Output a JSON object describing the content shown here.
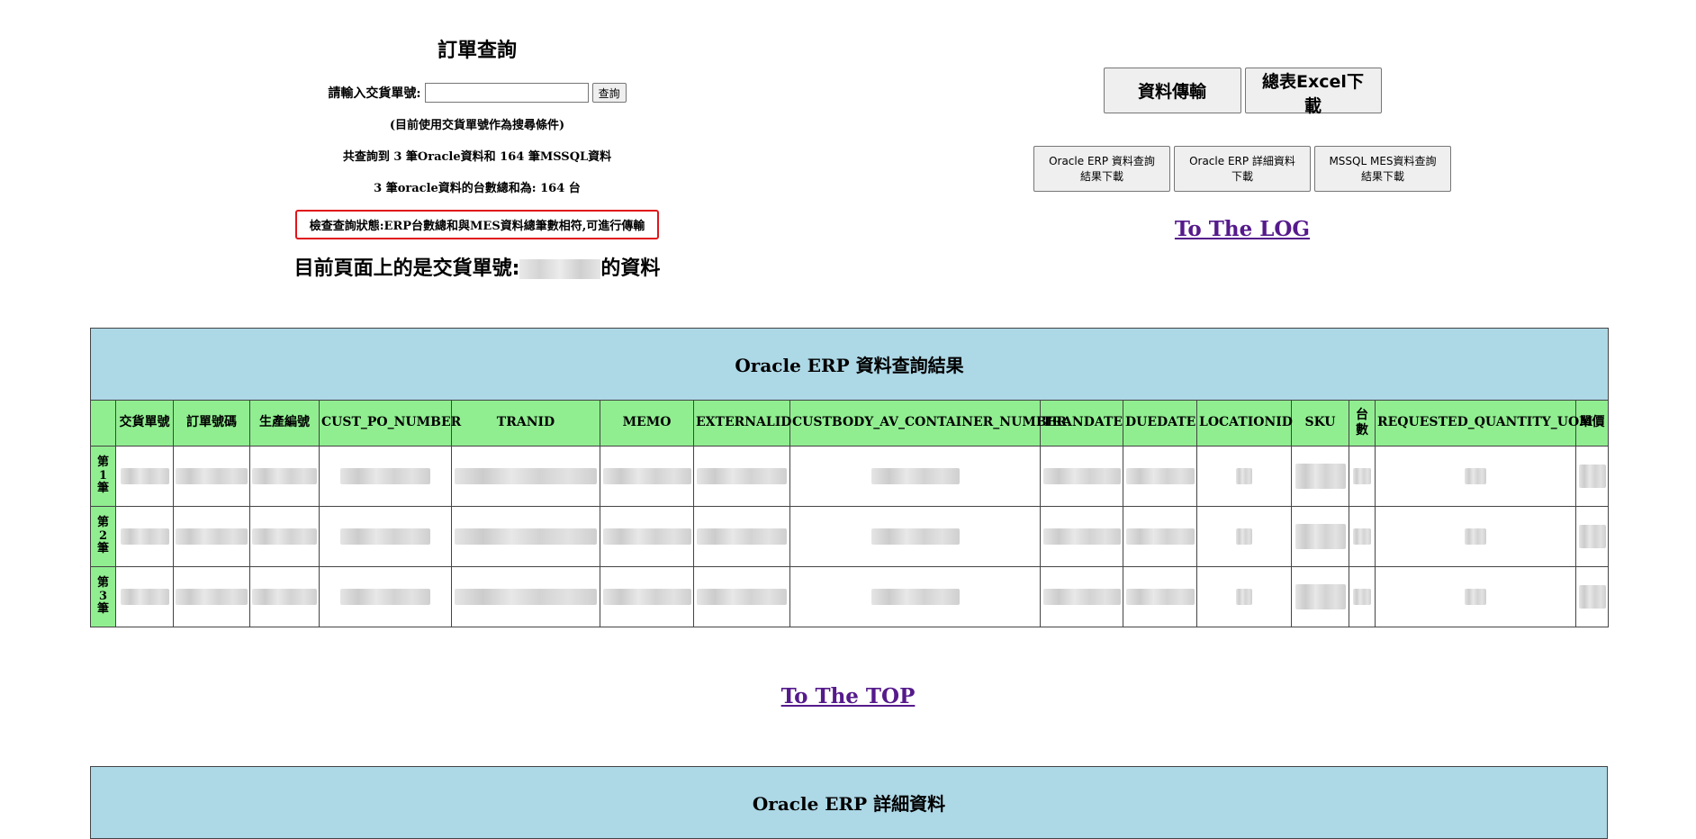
{
  "search": {
    "title": "訂單查詢",
    "input_label": "請輸入交貨單號:",
    "input_value": "",
    "input_placeholder": "",
    "query_button": "查詢",
    "hint": "(目前使用交貨單號作為搜尋條件)",
    "summary": "共查詢到 3 筆Oracle資料和 164 筆MSSQL資料",
    "total": "3 筆oracle資料的台數總和為: 164 台",
    "status": "檢查查詢狀態:ERP台數總和與MES資料總筆數相符,可進行傳輸",
    "current_prefix": "目前頁面上的是交貨單號:",
    "current_suffix": "的資料"
  },
  "actions": {
    "transfer_button": "資料傳輸",
    "excel_button": "總表Excel下載",
    "download_buttons": [
      {
        "line1": "Oracle ERP 資料查詢",
        "line2": "結果下載"
      },
      {
        "line1": "Oracle ERP 詳細資料",
        "line2": "下載"
      },
      {
        "line1": "MSSQL MES資料查詢",
        "line2": "結果下載"
      }
    ],
    "log_link": "To The LOG"
  },
  "erp_result": {
    "caption": "Oracle ERP 資料查詢結果",
    "columns": [
      "交貨單號",
      "訂單號碼",
      "生產編號",
      "CUST_PO_NUMBER",
      "TRANID",
      "MEMO",
      "EXTERNALID",
      "CUSTBODY_AV_CONTAINER_NUMBER",
      "TRANDATE",
      "DUEDATE",
      "LOCATIONID",
      "SKU",
      "台數",
      "REQUESTED_QUANTITY_UOM",
      "單價"
    ],
    "rows": [
      {
        "label_a": "第",
        "label_n": "1",
        "label_b": "筆"
      },
      {
        "label_a": "第",
        "label_n": "2",
        "label_b": "筆"
      },
      {
        "label_a": "第",
        "label_n": "3",
        "label_b": "筆"
      }
    ]
  },
  "top_link": "To The TOP",
  "erp_detail": {
    "caption": "Oracle ERP 詳細資料"
  }
}
